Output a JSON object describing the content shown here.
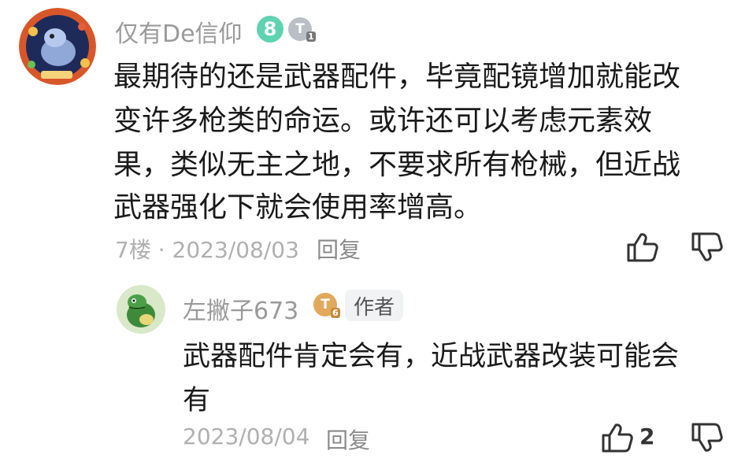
{
  "comment": {
    "username": "仅有De信仰",
    "level_badge": "8",
    "sub_badge": "T",
    "sub_badge_num": "1",
    "lines": [
      "最期待的还是武器配件，毕竟配镜增加就能改",
      "变许多枪类的命运。或许还可以考虑元素效",
      "果，类似无主之地，不要求所有枪械，但近战",
      "武器强化下就会使用率增高。"
    ],
    "floor": "7楼 · 2023/08/03",
    "reply_label": "回复",
    "like_icon": "thumbs-up-icon",
    "dislike_icon": "thumbs-down-icon"
  },
  "reply": {
    "username": "左撇子673",
    "sub_badge": "T",
    "sub_badge_num": "6",
    "author_tag": "作者",
    "lines": [
      "武器配件肯定会有，近战武器改装可能会",
      "有"
    ],
    "date": "2023/08/04",
    "reply_label": "回复",
    "like_count": "2",
    "like_icon": "thumbs-up-icon",
    "dislike_icon": "thumbs-down-icon"
  },
  "colors": {
    "level_badge": "#5fd3b0",
    "sub_badge_gray": "#b9bfc6",
    "sub_badge_gold": "#e2a85b"
  }
}
